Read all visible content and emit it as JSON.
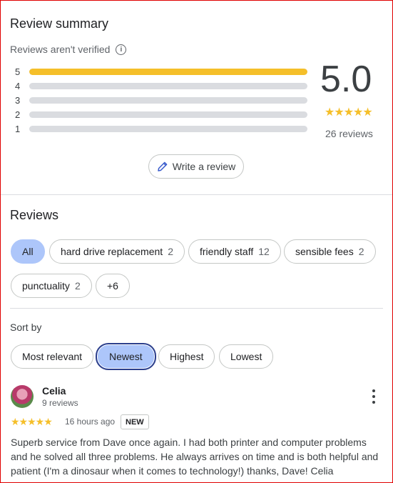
{
  "summary": {
    "title": "Review summary",
    "verified_note": "Reviews aren't verified",
    "rating": "5.0",
    "stars": "★★★★★",
    "count": "26 reviews",
    "write_review": "Write a review",
    "distribution": [
      {
        "label": "5",
        "fraction": 1.0
      },
      {
        "label": "4",
        "fraction": 0.0
      },
      {
        "label": "3",
        "fraction": 0.0
      },
      {
        "label": "2",
        "fraction": 0.0
      },
      {
        "label": "1",
        "fraction": 0.0
      }
    ]
  },
  "reviews": {
    "title": "Reviews",
    "chips": [
      {
        "label": "All",
        "count": ""
      },
      {
        "label": "hard drive replacement",
        "count": "2"
      },
      {
        "label": "friendly staff",
        "count": "12"
      },
      {
        "label": "sensible fees",
        "count": "2"
      },
      {
        "label": "punctuality",
        "count": "2"
      },
      {
        "label": "+6",
        "count": ""
      }
    ],
    "sort_label": "Sort by",
    "sort_options": [
      "Most relevant",
      "Newest",
      "Highest",
      "Lowest"
    ],
    "selected_sort": "Newest",
    "items": [
      {
        "name": "Celia",
        "meta": "9 reviews",
        "stars": "★★★★★",
        "time": "16 hours ago",
        "badge": "NEW",
        "text": "Superb service from Dave once again. I had both printer and computer problems and he solved all three problems. He always arrives on time and is both helpful and patient (I'm a dinosaur when it comes to technology!) thanks, Dave! Celia"
      }
    ]
  },
  "colors": {
    "star": "#f5bf2a",
    "selected_chip": "#adc6fa",
    "selected_border": "#2c3f8c"
  }
}
